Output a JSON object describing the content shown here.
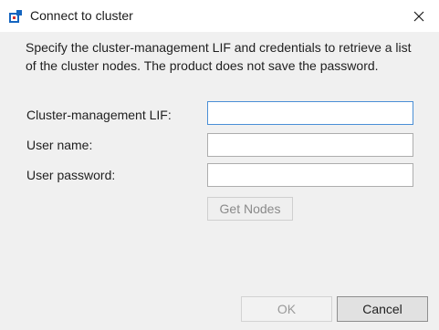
{
  "window": {
    "title": "Connect to cluster",
    "app_icon": "cluster-connect-icon",
    "close_icon": "close-icon"
  },
  "description": "Specify the cluster-management LIF and credentials to retrieve a list of the cluster nodes. The product does not save the password.",
  "fields": [
    {
      "label": "Cluster-management LIF:",
      "value": "",
      "placeholder": ""
    },
    {
      "label": "User name:",
      "value": "",
      "placeholder": ""
    },
    {
      "label": "User password:",
      "value": "",
      "placeholder": ""
    }
  ],
  "buttons": {
    "get_nodes": "Get Nodes",
    "ok": "OK",
    "cancel": "Cancel"
  },
  "colors": {
    "accent": "#1565c0",
    "focus_border": "#4a8fd6"
  }
}
